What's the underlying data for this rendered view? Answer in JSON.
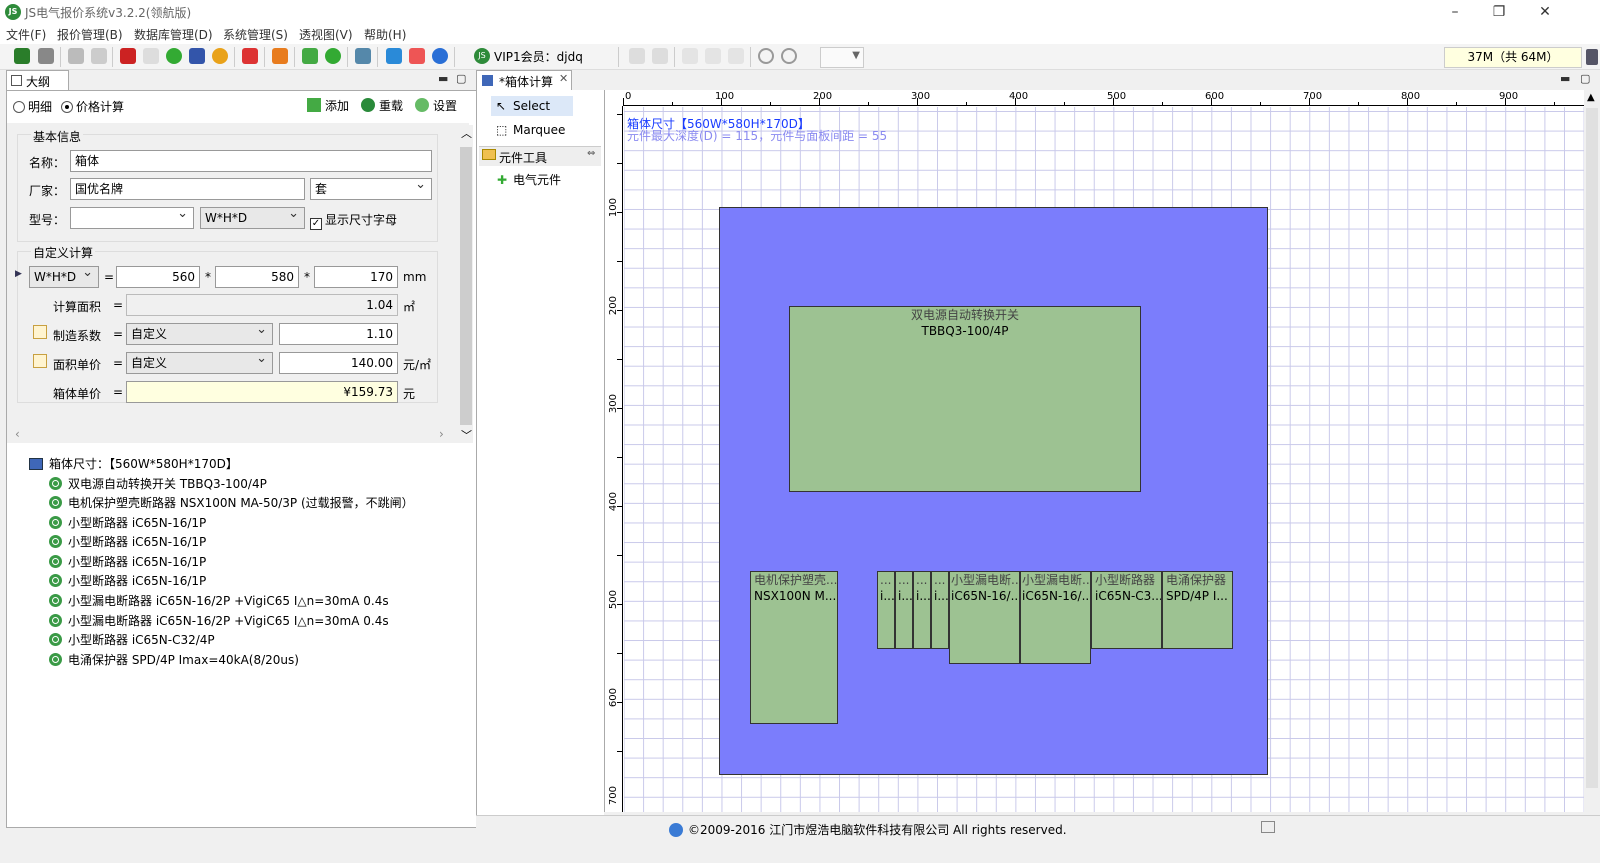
{
  "app": {
    "title": "JS电气报价系统v3.2.2(领航版)",
    "logo": "JS"
  },
  "menu": [
    "文件(F)",
    "报价管理(B)",
    "数据库管理(D)",
    "系统管理(S)",
    "透视图(V)",
    "帮助(H)"
  ],
  "toolbar": {
    "vip": "VIP1会员：djdq",
    "memory": "37M（共 64M）"
  },
  "outline": {
    "tab": "大纲",
    "radio_detail": "明细",
    "radio_price": "价格计算",
    "add": "添加",
    "reload": "重载",
    "settings": "设置",
    "basic_group": "基本信息",
    "name_label": "名称：",
    "name_value": "箱体",
    "maker_label": "厂家：",
    "maker_value": "国优名牌",
    "unit_value": "套",
    "model_label": "型号：",
    "model_value": "",
    "dim_format": "W*H*D",
    "show_size_label": "显示尺寸字母",
    "custom_group": "自定义计算",
    "calc_format": "W*H*D",
    "eq": "=",
    "times": "*",
    "w": "560",
    "h": "580",
    "d": "170",
    "mm": "mm",
    "area_label": "计算面积",
    "area_value": "1.04",
    "area_unit": "㎡",
    "mfg_label": "制造系数",
    "mfg_mode": "自定义",
    "mfg_value": "1.10",
    "unitprice_label": "面积单价",
    "unitprice_mode": "自定义",
    "unitprice_value": "140.00",
    "unitprice_unit": "元/㎡",
    "boxprice_label": "箱体单价",
    "boxprice_value": "¥159.73",
    "boxprice_unit": "元"
  },
  "tree": {
    "root": "箱体尺寸：【560W*580H*170D】",
    "items": [
      "双电源自动转换开关 TBBQ3-100/4P",
      "电机保护塑壳断路器 NSX100N MA-50/3P (过载报警，不跳闸）",
      "小型断路器 iC65N-16/1P",
      "小型断路器 iC65N-16/1P",
      "小型断路器 iC65N-16/1P",
      "小型断路器 iC65N-16/1P",
      "小型漏电断路器 iC65N-16/2P +VigiC65 I△n=30mA 0.4s",
      "小型漏电断路器 iC65N-16/2P +VigiC65 I△n=30mA 0.4s",
      "小型断路器 iC65N-C32/4P",
      "电涌保护器 SPD/4P Imax=40kA(8/20us)"
    ]
  },
  "designer": {
    "tab": "*箱体计算",
    "tools": {
      "select": "Select",
      "marquee": "Marquee",
      "elem_tools": "元件工具",
      "elec": "电气元件"
    },
    "hruler": [
      "0",
      "100",
      "200",
      "300",
      "400",
      "500",
      "600",
      "700",
      "800",
      "900"
    ],
    "vruler": [
      "100",
      "200",
      "300",
      "400",
      "500",
      "600",
      "700"
    ],
    "dim_line1": "箱体尺寸【560W*580H*170D】",
    "dim_line2": "元件最大深度(D) = 115，元件与面板间距 = 55",
    "components": [
      {
        "l1": "双电源自动转换开关",
        "l2": "TBBQ3-100/4P"
      },
      {
        "l1": "电机保护塑壳...",
        "l2": "NSX100N M..."
      },
      {
        "l1": "...",
        "l2": "i..."
      },
      {
        "l1": "...",
        "l2": "i..."
      },
      {
        "l1": "...",
        "l2": "i..."
      },
      {
        "l1": "...",
        "l2": "i..."
      },
      {
        "l1": "小型漏电断...",
        "l2": "iC65N-16/..."
      },
      {
        "l1": "小型漏电断...",
        "l2": "iC65N-16/..."
      },
      {
        "l1": "小型断路器",
        "l2": "iC65N-C3..."
      },
      {
        "l1": "电涌保护器",
        "l2": "SPD/4P I..."
      }
    ]
  },
  "status": {
    "copyright": "©2009-2016 江门市煜浩电脑软件科技有限公司 All rights reserved."
  },
  "colors": {
    "box": "#7b7dfc",
    "component": "#9dc292",
    "accent": "#1a3cff"
  }
}
